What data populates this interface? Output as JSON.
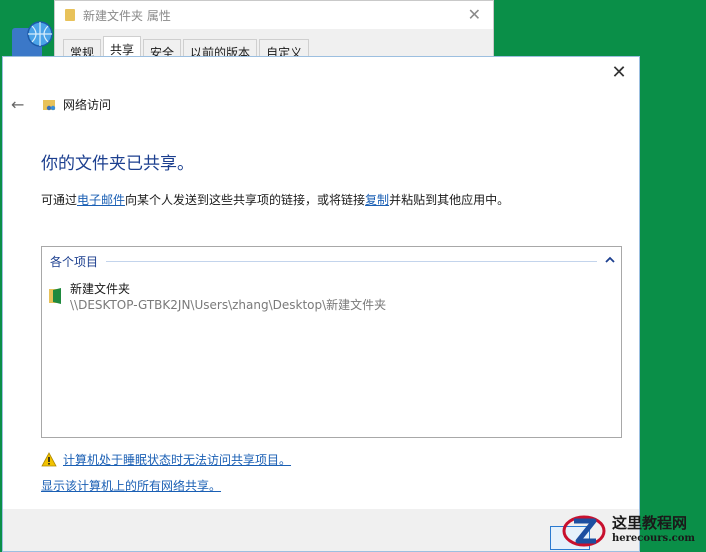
{
  "properties_window": {
    "title": "新建文件夹 属性",
    "close_glyph": "✕",
    "tabs": [
      "常规",
      "共享",
      "安全",
      "以前的版本",
      "自定义"
    ],
    "active_tab": "共享"
  },
  "dialog": {
    "close_glyph": "✕",
    "back_glyph": "←",
    "nav_title": "网络访问",
    "heading": "你的文件夹已共享。",
    "desc": {
      "pre": "可通过",
      "link1": "电子邮件",
      "mid": "向某个人发送到这些共享项的链接，或将链接",
      "link2": "复制",
      "post": "并粘贴到其他应用中。"
    },
    "items_header": "各个项目",
    "items_chevron": "⌃",
    "items": [
      {
        "name": "新建文件夹",
        "path": "\\\\DESKTOP-GTBK2JN\\Users\\zhang\\Desktop\\新建文件夹"
      }
    ],
    "warning_link": "计算机处于睡眠状态时无法访问共享项目。",
    "show_all_link": "显示该计算机上的所有网络共享。"
  },
  "watermark": {
    "title": "这里教程网",
    "url": "herecours.com"
  },
  "colors": {
    "desktop": "#0a8f48",
    "heading": "#1c3f8f",
    "link": "#1a5fb4"
  },
  "icons": [
    "globe-icon",
    "folder-icon",
    "close-icon",
    "back-arrow-icon",
    "network-folder-icon",
    "chevron-up-icon",
    "green-folder-icon",
    "warning-icon"
  ]
}
